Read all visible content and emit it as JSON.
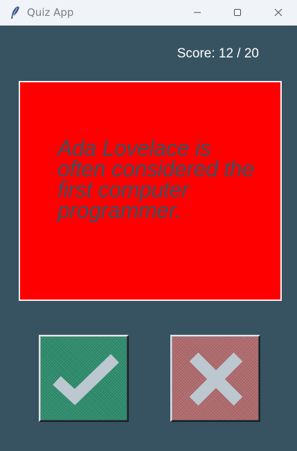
{
  "window": {
    "title": "Quiz App",
    "app_icon": "feather-icon"
  },
  "titlebar_buttons": [
    {
      "name": "minimize",
      "icon": "minimize-icon"
    },
    {
      "name": "maximize",
      "icon": "maximize-icon"
    },
    {
      "name": "close",
      "icon": "close-icon"
    }
  ],
  "score": {
    "label": "Score: 12 / 20"
  },
  "question": {
    "text": "Ada Lovelace is often considered the first computer programmer."
  },
  "answers": {
    "true_icon": "checkmark-icon",
    "false_icon": "cross-icon"
  },
  "colors": {
    "background": "#375362",
    "card": "#ff0000",
    "question_text": "#375362",
    "true_button": "#2d8c6c",
    "false_button": "#b06a6c",
    "icon": "#bcc8cf"
  }
}
